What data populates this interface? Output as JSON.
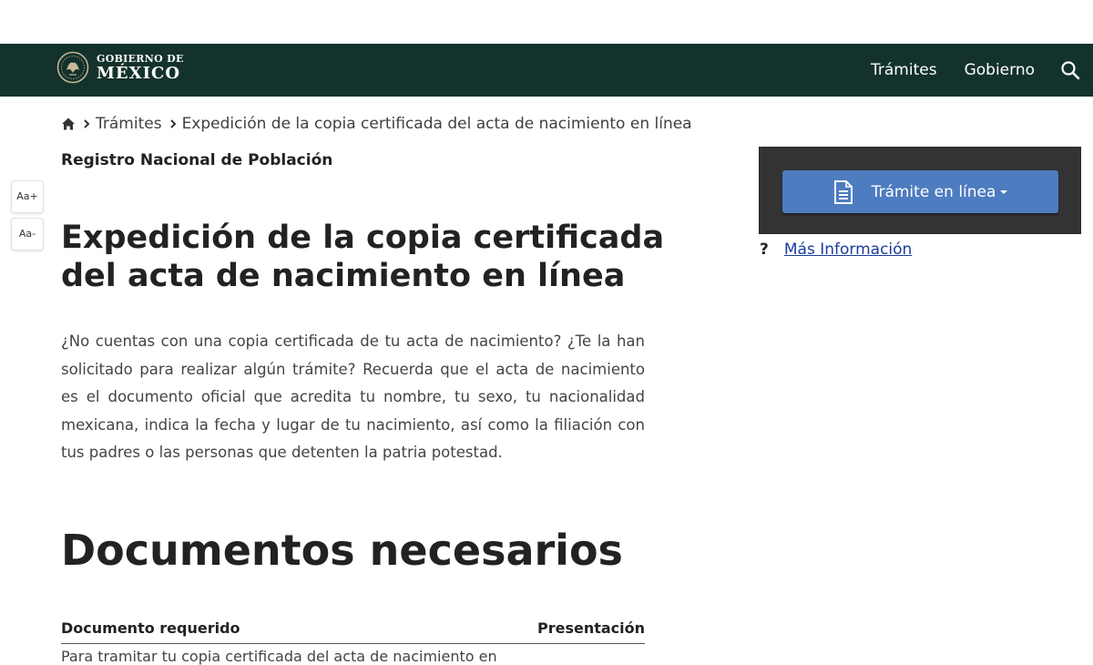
{
  "header": {
    "logo_line1": "GOBIERNO DE",
    "logo_line2": "MÉXICO",
    "nav": [
      "Trámites",
      "Gobierno"
    ],
    "search_icon": "search-icon",
    "background": "#13322b"
  },
  "breadcrumb": {
    "home_icon": "home-icon",
    "items": [
      "Trámites",
      "Expedición de la copia certificada del acta de nacimiento en línea"
    ]
  },
  "dependency": "Registro Nacional de Población",
  "font_controls": {
    "increase": "Aa+",
    "decrease": "Aa-"
  },
  "main": {
    "title": "Expedición de la copia certificada del acta de nacimiento en línea",
    "intro": "¿No cuentas con una copia certificada de tu acta de nacimiento? ¿Te la han solicitado para realizar algún trámite? Recuerda que el acta de nacimiento es el documento oficial que acredita tu nombre, tu sexo, tu nacionalidad mexicana, indica la fecha y lugar de tu nacimiento, así como la filiación con tus padres o las personas que detenten la patria potestad.",
    "section_title": "Documentos necesarios",
    "table": {
      "headers": [
        "Documento requerido",
        "Presentación"
      ],
      "rows": [
        {
          "documento": "Para tramitar tu copia certificada del acta de nacimiento en"
        }
      ]
    }
  },
  "sidebar": {
    "action_button": "Trámite en línea",
    "action_icon": "document-icon",
    "more_info_mark": "?",
    "more_info": "Más Información",
    "button_color": "#4d7cc0",
    "panel_color": "#333333"
  }
}
